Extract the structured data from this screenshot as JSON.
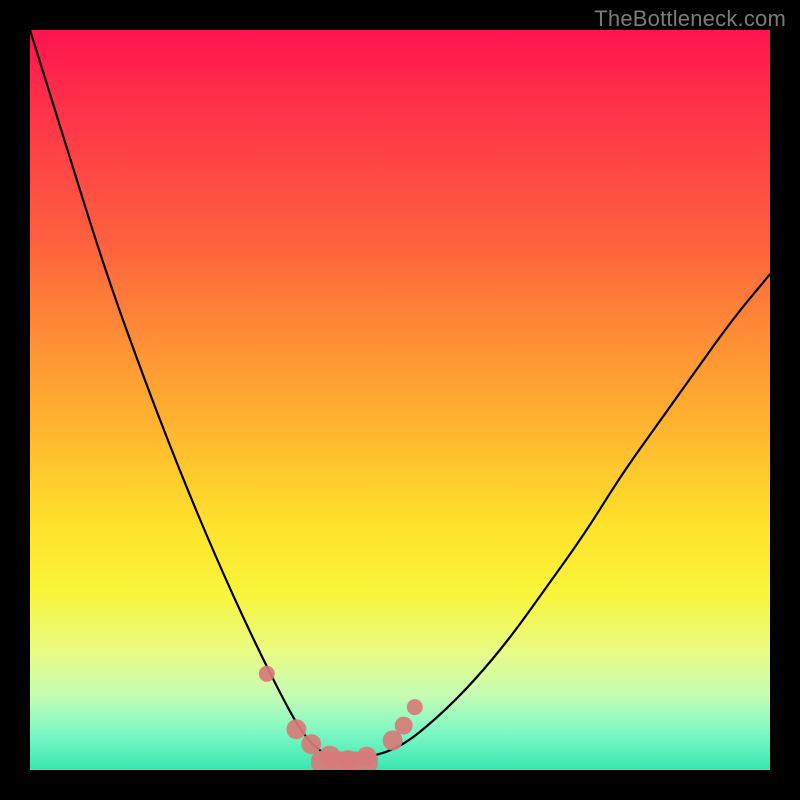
{
  "watermark": "TheBottleneck.com",
  "chart_data": {
    "type": "line",
    "title": "",
    "xlabel": "",
    "ylabel": "",
    "x": [
      0.0,
      0.05,
      0.1,
      0.15,
      0.2,
      0.25,
      0.3,
      0.35,
      0.375,
      0.4,
      0.425,
      0.45,
      0.5,
      0.55,
      0.6,
      0.65,
      0.7,
      0.75,
      0.8,
      0.85,
      0.9,
      0.95,
      1.0
    ],
    "y": [
      1.0,
      0.84,
      0.68,
      0.54,
      0.41,
      0.29,
      0.18,
      0.08,
      0.04,
      0.02,
      0.01,
      0.015,
      0.03,
      0.07,
      0.12,
      0.18,
      0.25,
      0.32,
      0.4,
      0.47,
      0.54,
      0.61,
      0.67
    ],
    "xlim": [
      0,
      1
    ],
    "ylim": [
      0,
      1
    ],
    "minimum_x": 0.425,
    "markers": [
      {
        "x": 0.32,
        "y": 0.13,
        "r": 8
      },
      {
        "x": 0.36,
        "y": 0.055,
        "r": 10
      },
      {
        "x": 0.38,
        "y": 0.035,
        "r": 10
      },
      {
        "x": 0.405,
        "y": 0.018,
        "r": 11
      },
      {
        "x": 0.43,
        "y": 0.012,
        "r": 11
      },
      {
        "x": 0.455,
        "y": 0.018,
        "r": 10
      },
      {
        "x": 0.49,
        "y": 0.04,
        "r": 10
      },
      {
        "x": 0.505,
        "y": 0.06,
        "r": 9
      },
      {
        "x": 0.52,
        "y": 0.085,
        "r": 8
      }
    ],
    "bottom_band": {
      "x0": 0.38,
      "x1": 0.47,
      "y": 0.005,
      "h": 0.02
    }
  },
  "colors": {
    "frame": "#000000",
    "curve": "#000000",
    "marker": "#d77b7a",
    "watermark": "#7b7b7b"
  }
}
